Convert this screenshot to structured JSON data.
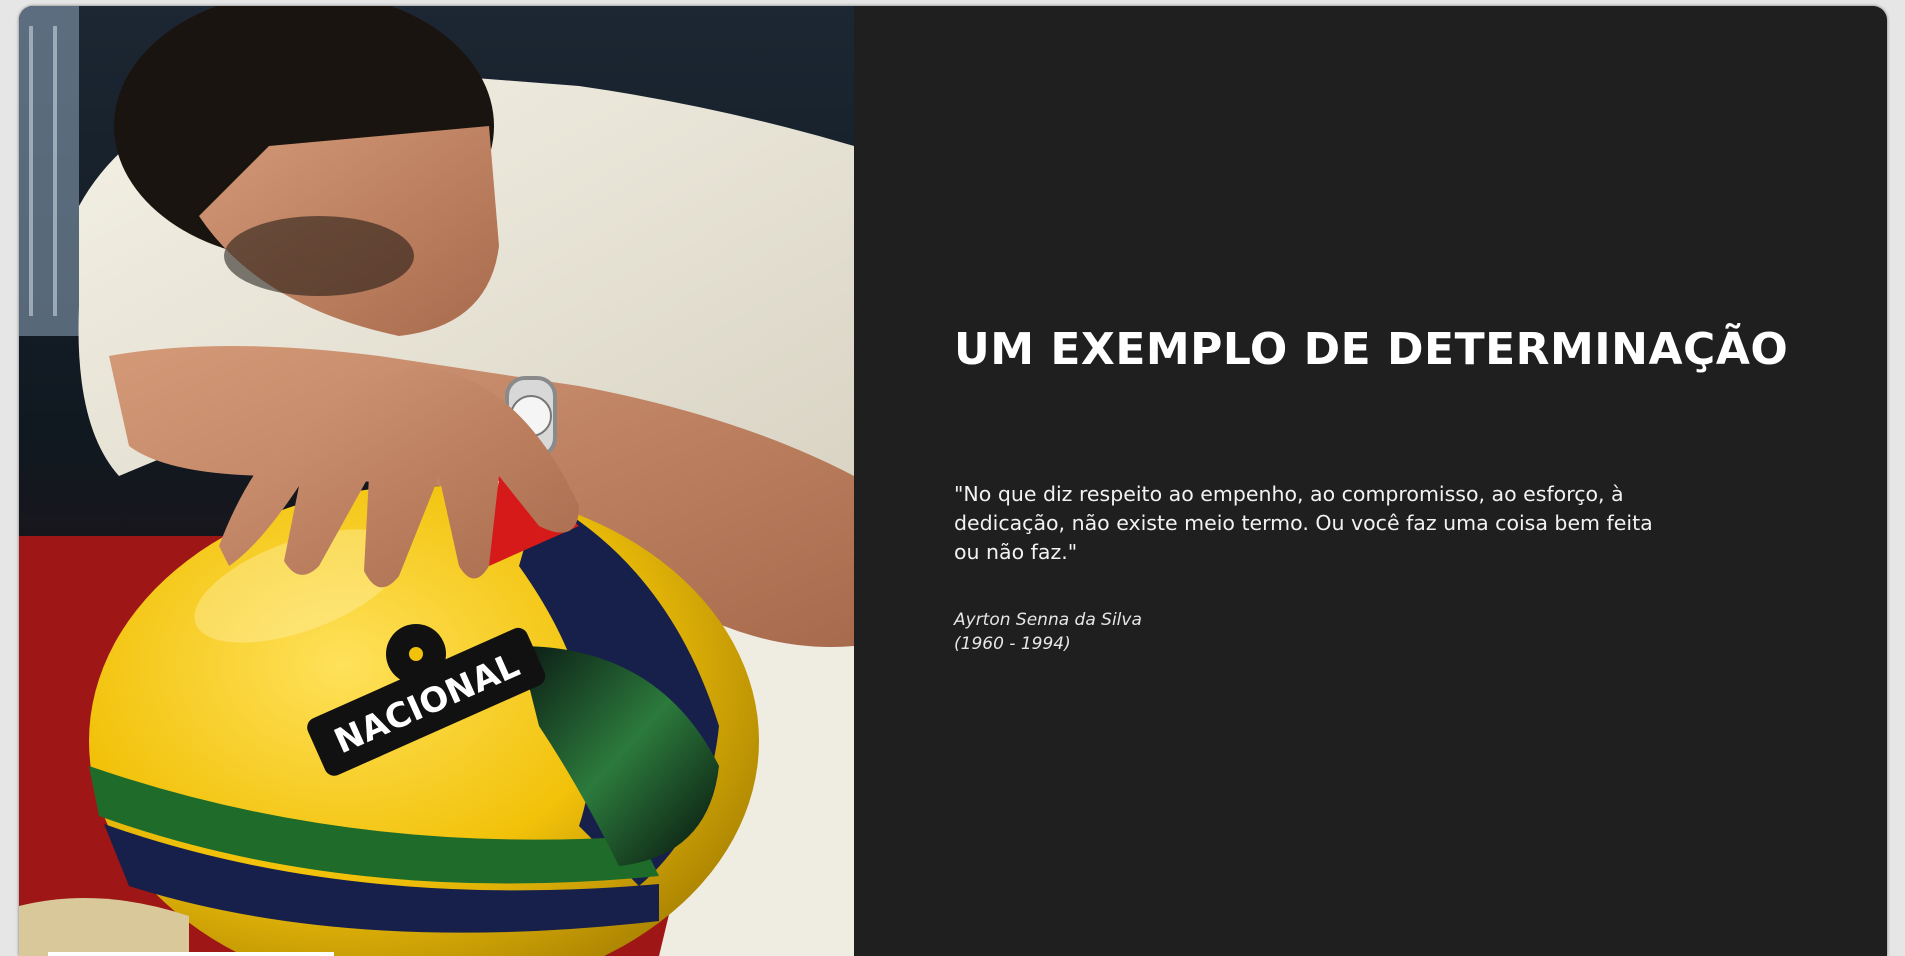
{
  "section": {
    "title": "UM EXEMPLO DE DETERMINAÇÃO",
    "quote": "\"No que diz respeito ao empenho, ao compromisso, ao esforço, à dedicação, não existe meio termo. Ou você faz uma coisa bem feita ou não faz.\"",
    "author_name": "Ayrton Senna da Silva",
    "author_years": "(1960 - 1994)"
  },
  "photo": {
    "helmet_text_front": "NACIONAL"
  },
  "colors": {
    "panel_background": "#1f1f1f",
    "helmet_yellow": "#f2c20a",
    "helmet_green": "#1f6b2a",
    "helmet_navy": "#16204a",
    "text": "#ffffff"
  }
}
